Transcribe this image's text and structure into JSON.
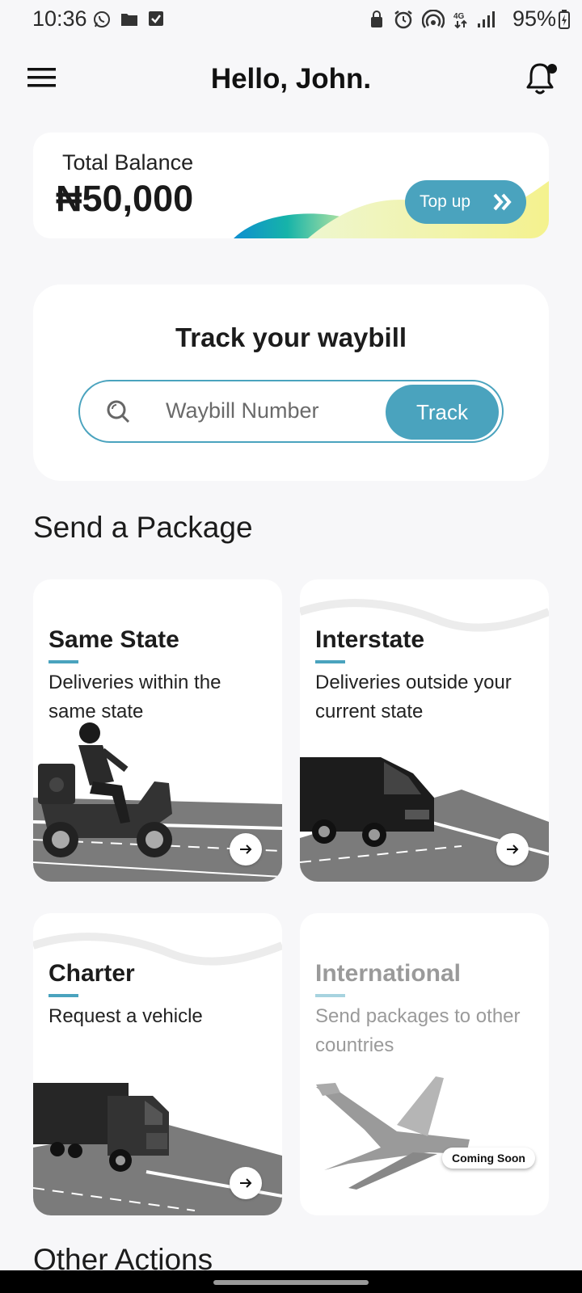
{
  "status_bar": {
    "time": "10:36",
    "battery": "95%",
    "left_icons": [
      "whatsapp-icon",
      "folder-icon",
      "checkbox-icon"
    ],
    "right_icons": [
      "lock-icon",
      "alarm-icon",
      "hotspot-icon",
      "4g-icon",
      "signal-icon"
    ]
  },
  "header": {
    "title": "Hello, John.",
    "menu_icon": "menu-icon",
    "notification_icon": "bell-icon"
  },
  "balance": {
    "label": "Total Balance",
    "amount": "₦50,000",
    "topup_label": "Top up"
  },
  "track": {
    "title": "Track your waybill",
    "placeholder": "Waybill Number",
    "value": "",
    "button_label": "Track"
  },
  "send_package": {
    "section_title": "Send a Package",
    "cards": [
      {
        "title": "Same State",
        "description": "Deliveries within the same state",
        "enabled": true
      },
      {
        "title": "Interstate",
        "description": "Deliveries outside your current state",
        "enabled": true
      },
      {
        "title": "Charter",
        "description": "Request a vehicle",
        "enabled": true
      },
      {
        "title": "International",
        "description": "Send packages to other countries",
        "enabled": false,
        "badge": "Coming Soon"
      }
    ]
  },
  "other_actions": {
    "section_title": "Other Actions"
  },
  "colors": {
    "accent": "#4aa3be",
    "background": "#f7f7f9",
    "card": "#ffffff"
  }
}
